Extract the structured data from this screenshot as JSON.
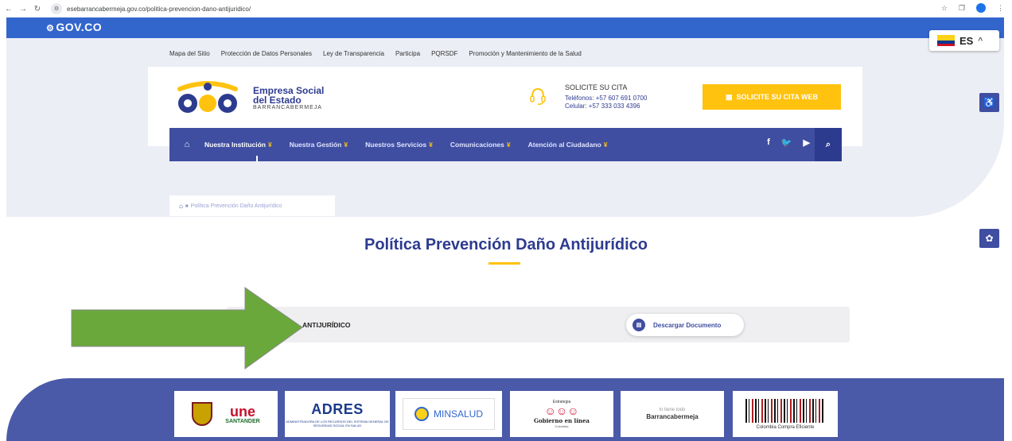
{
  "browser": {
    "url": "esebarrancabermeja.gov.co/politica-prevencion-dano-antijuridico/"
  },
  "gov_bar": {
    "logo": "GOV.CO"
  },
  "language": {
    "selected": "ES"
  },
  "top_links": [
    "Mapa del Sitio",
    "Protección de Datos Personales",
    "Ley de Transparencia",
    "Participa",
    "PQRSDF",
    "Promoción y Mantenimiento de la Salud"
  ],
  "logo": {
    "line1": "Empresa Social",
    "line2": "del Estado",
    "line3": "BARRANCABERMEJA"
  },
  "cita": {
    "title": "SOLICITE SU CITA",
    "phones": "Teléfonos: +57 607 691 0700",
    "cell": "Celular: +57 333 033 4396",
    "button": "SOLICITE SU CITA WEB"
  },
  "nav": {
    "items": [
      {
        "label": "Nuestra Institución"
      },
      {
        "label": "Nuestra Gestión"
      },
      {
        "label": "Nuestros Servicios"
      },
      {
        "label": "Comunicaciones"
      },
      {
        "label": "Atención al Ciudadano"
      }
    ]
  },
  "breadcrumb": {
    "current": "Política Prevención Daño Antijurídico"
  },
  "page": {
    "title": "Política Prevención Daño Antijurídico",
    "doc_label": "ANTIJURÍDICO",
    "download_button": "Descargar Documento"
  },
  "footer_logos": {
    "santander_une": "une",
    "santander": "SANTANDER",
    "adres": "ADRES",
    "adres_sub": "ADMINISTRADORA DE LOS RECURSOS DEL SISTEMA GENERAL DE SEGURIDAD SOCIAL EN SALUD",
    "minsalud": "MINSALUD",
    "gobierno_top": "Estrategia",
    "gobierno": "Gobierno en línea",
    "gobierno_sub": "Colombia",
    "barranca_small": "lo tiene todo",
    "barranca": "Barrancabermeja",
    "compro": "Colombia Compra Eficiente"
  },
  "colors": {
    "gov_blue": "#3366cc",
    "nav_blue": "#3f4ea1",
    "accent_yellow": "#ffc20e",
    "arrow_green": "#6aa83c"
  }
}
